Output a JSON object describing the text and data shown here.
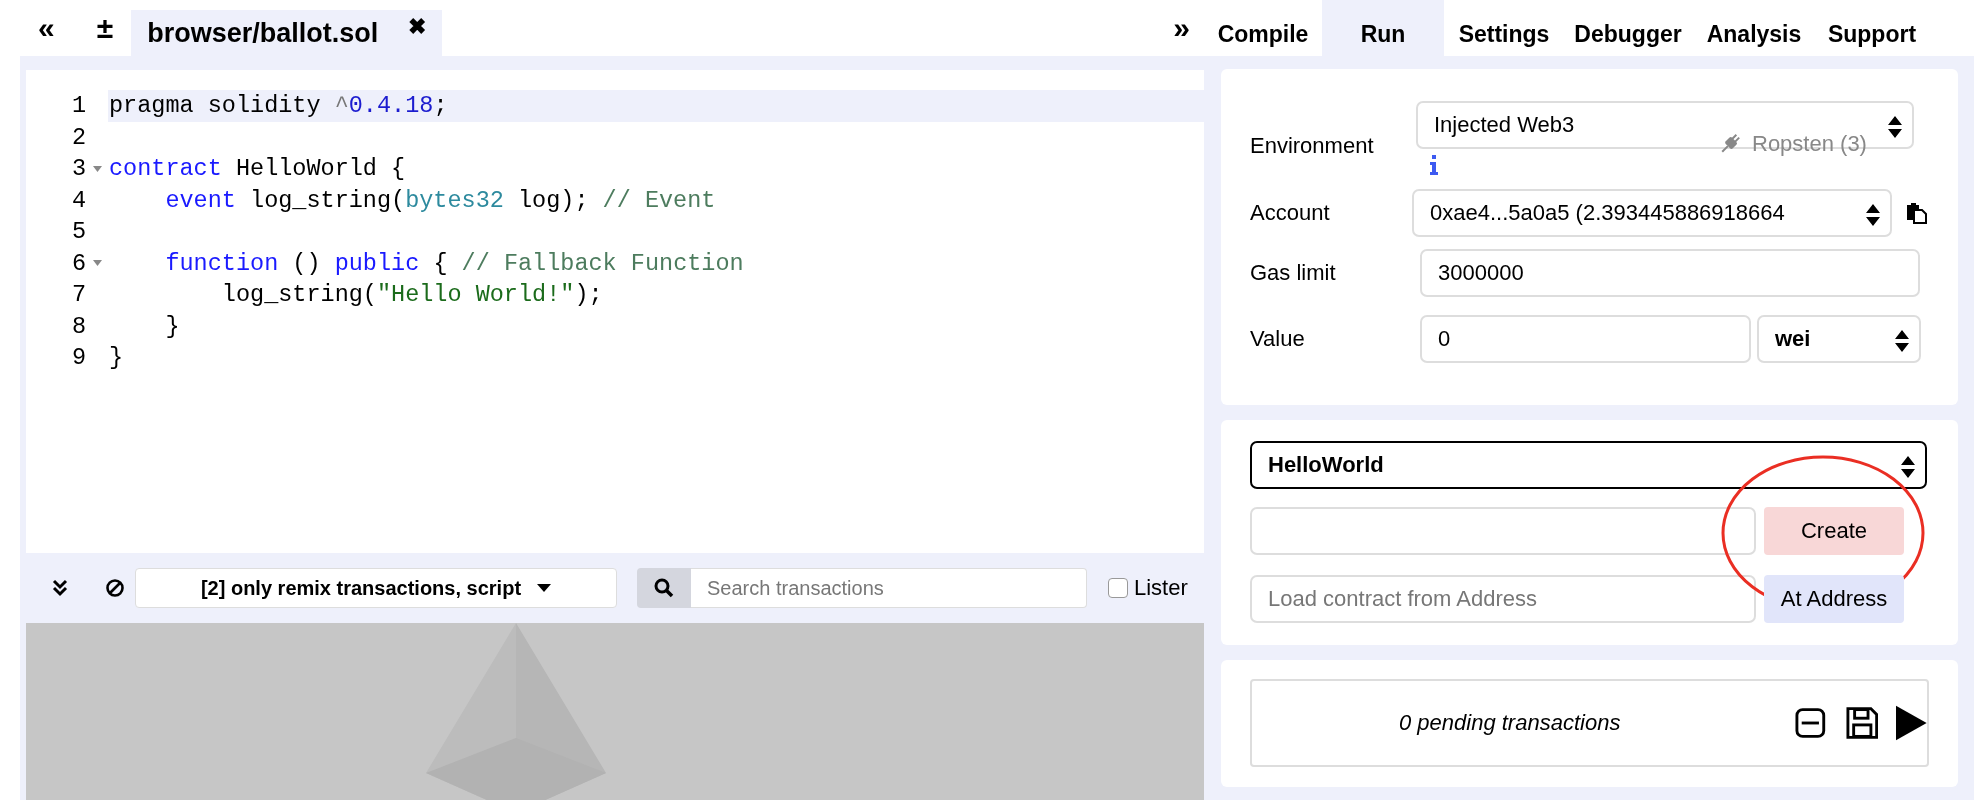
{
  "editor": {
    "collapse_icon": "«",
    "new_file_icon": "±",
    "expand_icon": "»",
    "file_tabs": [
      {
        "label": "browser/ballot.sol",
        "selected": true,
        "close": "✖"
      }
    ],
    "lines": [
      {
        "number": "1",
        "active": true,
        "foldable": false,
        "tokens": [
          {
            "kind": "plain",
            "text": "pragma solidity "
          },
          {
            "kind": "operator",
            "text": "^"
          },
          {
            "kind": "number",
            "text": "0.4.18"
          },
          {
            "kind": "plain",
            "text": ";"
          }
        ]
      },
      {
        "number": "2",
        "active": false,
        "foldable": false
      },
      {
        "number": "3",
        "active": false,
        "foldable": true,
        "tokens": [
          {
            "kind": "keyword",
            "text": "contract"
          },
          {
            "kind": "plain",
            "text": " HelloWorld {"
          }
        ]
      },
      {
        "number": "4",
        "active": false,
        "foldable": false,
        "tokens": [
          {
            "kind": "keyword",
            "text": "    event"
          },
          {
            "kind": "plain",
            "text": " log_string("
          },
          {
            "kind": "type",
            "text": "bytes32"
          },
          {
            "kind": "plain",
            "text": " log); "
          },
          {
            "kind": "comment",
            "text": "// Event"
          }
        ]
      },
      {
        "number": "5",
        "active": false,
        "foldable": false
      },
      {
        "number": "6",
        "active": false,
        "foldable": true,
        "tokens": [
          {
            "kind": "keyword",
            "text": "    function"
          },
          {
            "kind": "plain",
            "text": " () "
          },
          {
            "kind": "keyword",
            "text": "public"
          },
          {
            "kind": "plain",
            "text": " { "
          },
          {
            "kind": "comment",
            "text": "// Fallback Function"
          }
        ]
      },
      {
        "number": "7",
        "active": false,
        "foldable": false,
        "tokens": [
          {
            "kind": "plain",
            "text": "        log_string("
          },
          {
            "kind": "string",
            "text": "\"Hello World!\""
          },
          {
            "kind": "plain",
            "text": ");"
          }
        ]
      },
      {
        "number": "8",
        "active": false,
        "foldable": false,
        "tokens": [
          {
            "kind": "plain",
            "text": "    }"
          }
        ]
      },
      {
        "number": "9",
        "active": false,
        "foldable": false,
        "tokens": [
          {
            "kind": "plain",
            "text": "}"
          }
        ]
      }
    ]
  },
  "terminal": {
    "filter": "[2] only remix transactions, script",
    "search_placeholder": "Search transactions",
    "listen": {
      "label": "Lister",
      "checked": false
    }
  },
  "right_tabs": [
    {
      "label": "Compile",
      "selected": false
    },
    {
      "label": "Run",
      "selected": true
    },
    {
      "label": "Settings",
      "selected": false
    },
    {
      "label": "Debugger",
      "selected": false
    },
    {
      "label": "Analysis",
      "selected": false
    },
    {
      "label": "Support",
      "selected": false
    }
  ],
  "run": {
    "environment": {
      "label": "Environment",
      "value": "Injected Web3",
      "network": "Ropsten (3)"
    },
    "account": {
      "label": "Account",
      "value": "0xae4...5a0a5 (2.393445886918664"
    },
    "gas_limit": {
      "label": "Gas limit",
      "value": "3000000"
    },
    "value": {
      "label": "Value",
      "value": "0",
      "unit": "wei"
    },
    "contract": {
      "value": "HelloWorld",
      "create": "Create",
      "address_placeholder": "Load contract from Address",
      "at_address": "At Address"
    },
    "pending": {
      "text": "0 pending transactions"
    }
  }
}
